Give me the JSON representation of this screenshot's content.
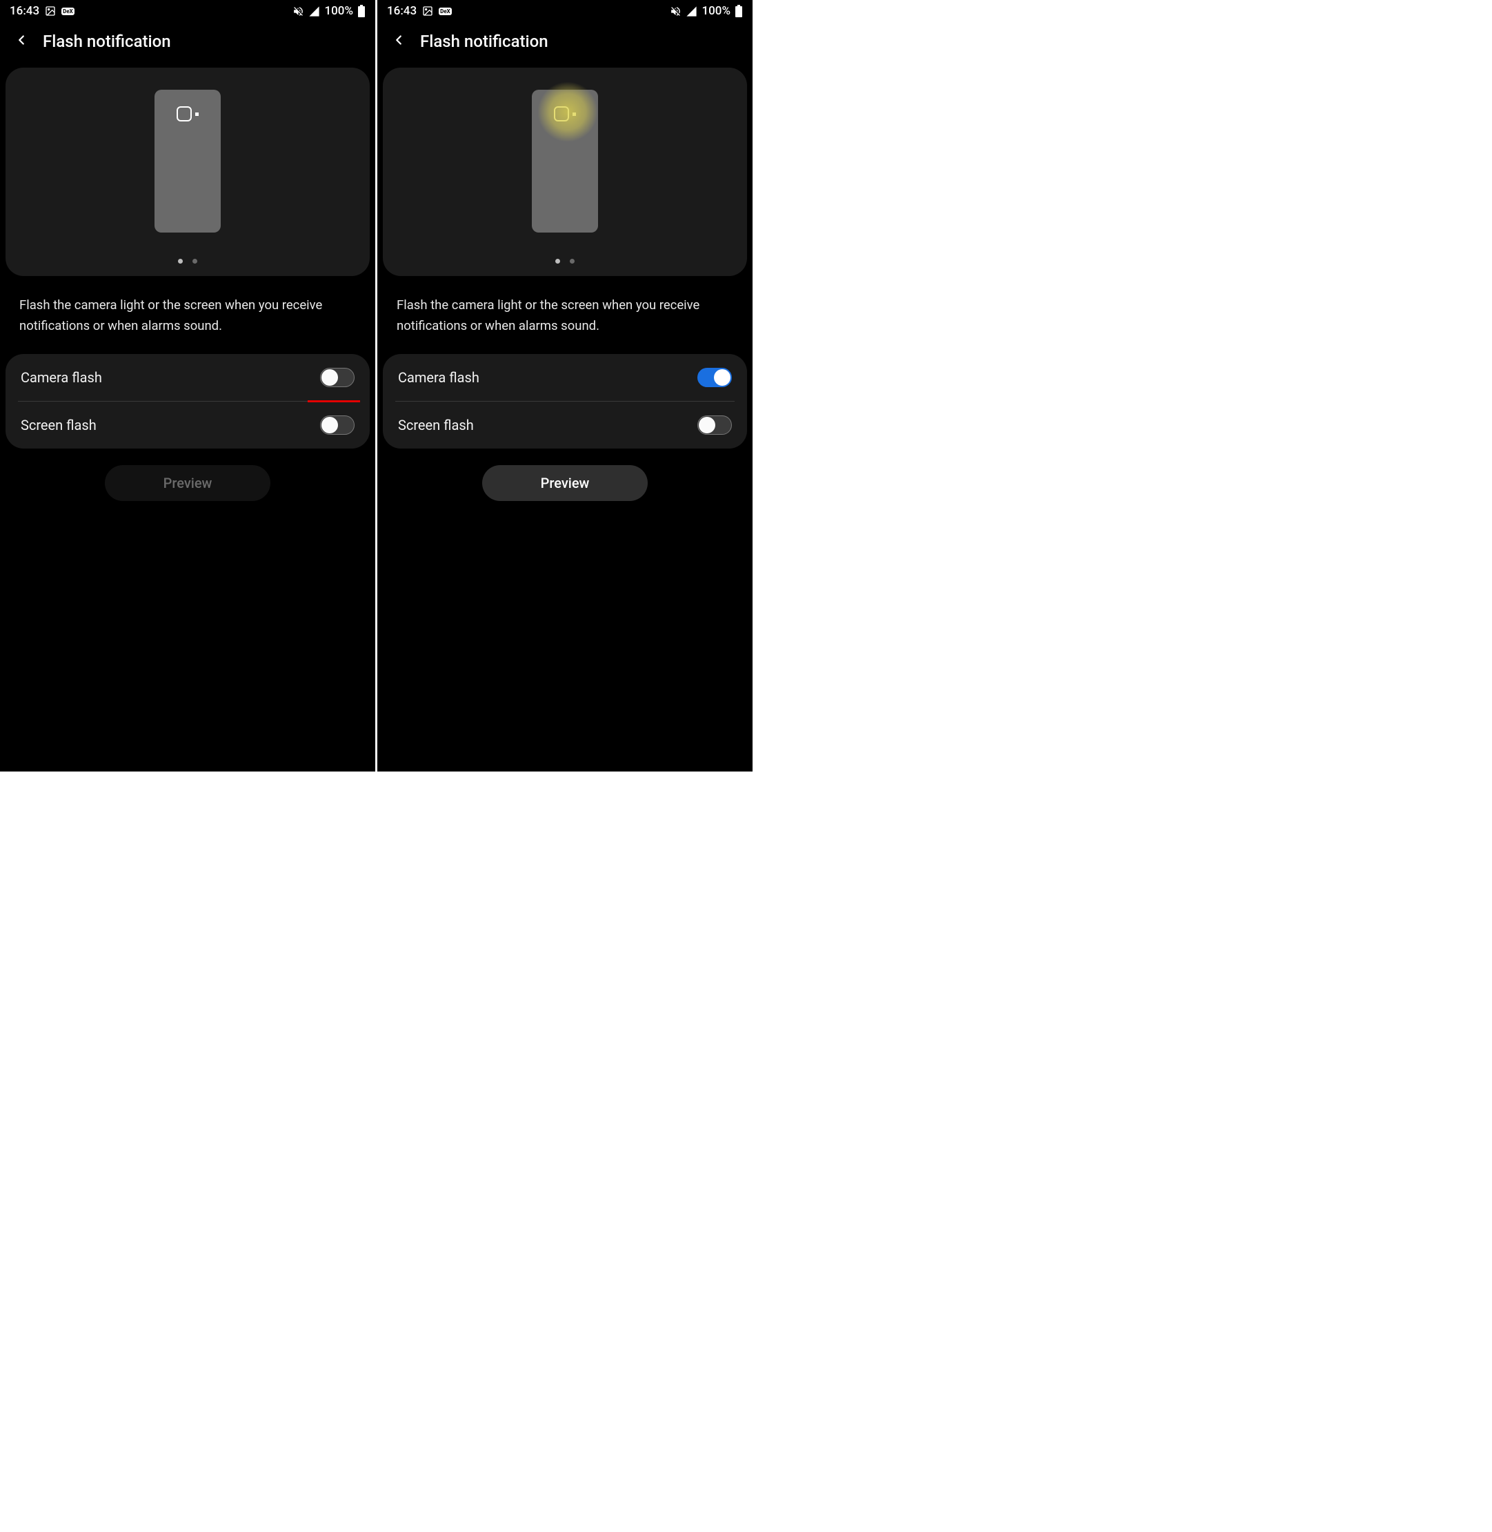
{
  "status": {
    "time": "16:43",
    "battery_text": "100%"
  },
  "header": {
    "title": "Flash notification"
  },
  "description": "Flash the camera light or the screen when you receive notifications or when alarms sound.",
  "settings": {
    "camera_flash_label": "Camera flash",
    "screen_flash_label": "Screen flash"
  },
  "preview_button": "Preview",
  "screens": {
    "left": {
      "camera_flash_on": false,
      "screen_flash_on": false,
      "preview_enabled": false,
      "flash_glow": false,
      "pager_active": 0,
      "show_red_underline": true
    },
    "right": {
      "camera_flash_on": true,
      "screen_flash_on": false,
      "preview_enabled": true,
      "flash_glow": true,
      "pager_active": 0,
      "show_red_underline": false
    }
  }
}
